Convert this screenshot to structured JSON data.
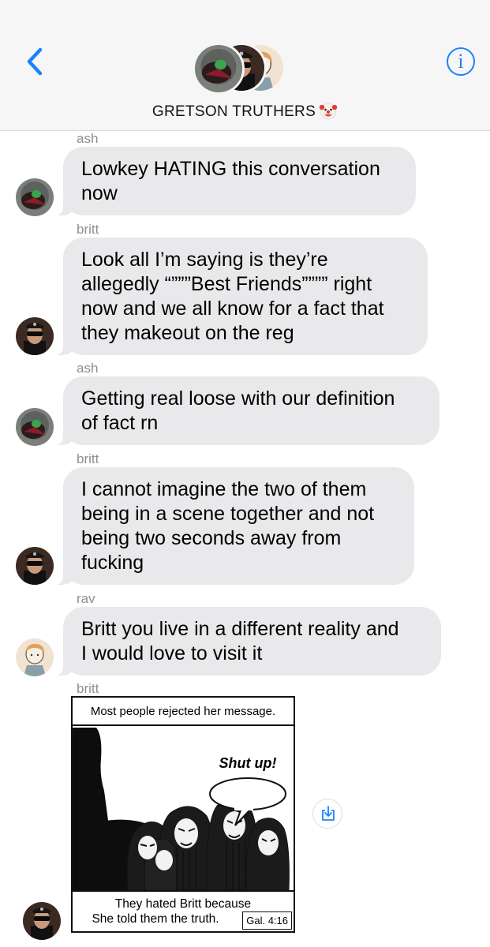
{
  "header": {
    "group_name": "GRETSON TRUTHERS",
    "title_emoji": "clown-face-emoji",
    "back_icon": "chevron-left-icon",
    "info_icon": "info-icon",
    "info_glyph": "i",
    "accent_color": "#1a82fb"
  },
  "messages": [
    {
      "sender": "ash",
      "text": "Lowkey HATING this conversation now",
      "lines": [
        "Lowkey HATING this conversation",
        "now"
      ]
    },
    {
      "sender": "britt",
      "text": "Look all I’m saying is they’re allegedly “”””Best Friends”””” right now and we all know for a fact that they makeout on the reg",
      "lines": [
        "Look all I’m saying is they’re",
        "allegedly “”””Best Friends”””” right",
        "now and we all know for a fact that",
        "they makeout on the reg"
      ]
    },
    {
      "sender": "ash",
      "text": "Getting real loose with our definition of fact rn",
      "lines": [
        "Getting real loose with our definition",
        "of fact rn"
      ]
    },
    {
      "sender": "britt",
      "text": "I cannot imagine the two of them being in a scene together and not being two seconds away from fucking",
      "lines": [
        "I cannot imagine the two of them",
        "being in a scene together and not",
        "being two seconds away from",
        "fucking"
      ]
    },
    {
      "sender": "rav",
      "text": "Britt you live in a different reality and I would love to visit it",
      "lines": [
        "Britt you live in a different reality and",
        "I would love to visit it"
      ]
    }
  ],
  "image_message": {
    "sender": "britt",
    "caption_top": "Most people rejected her message.",
    "speech": "Shut up!",
    "caption_bottom_1": "They hated Britt because",
    "caption_bottom_2": "She told them the truth.",
    "reference": "Gal. 4:16",
    "save_icon": "save-image-icon"
  },
  "colors": {
    "bubble": "#e9e9eb",
    "sender_label": "#8e8e93",
    "header_bg": "#f6f6f7"
  }
}
